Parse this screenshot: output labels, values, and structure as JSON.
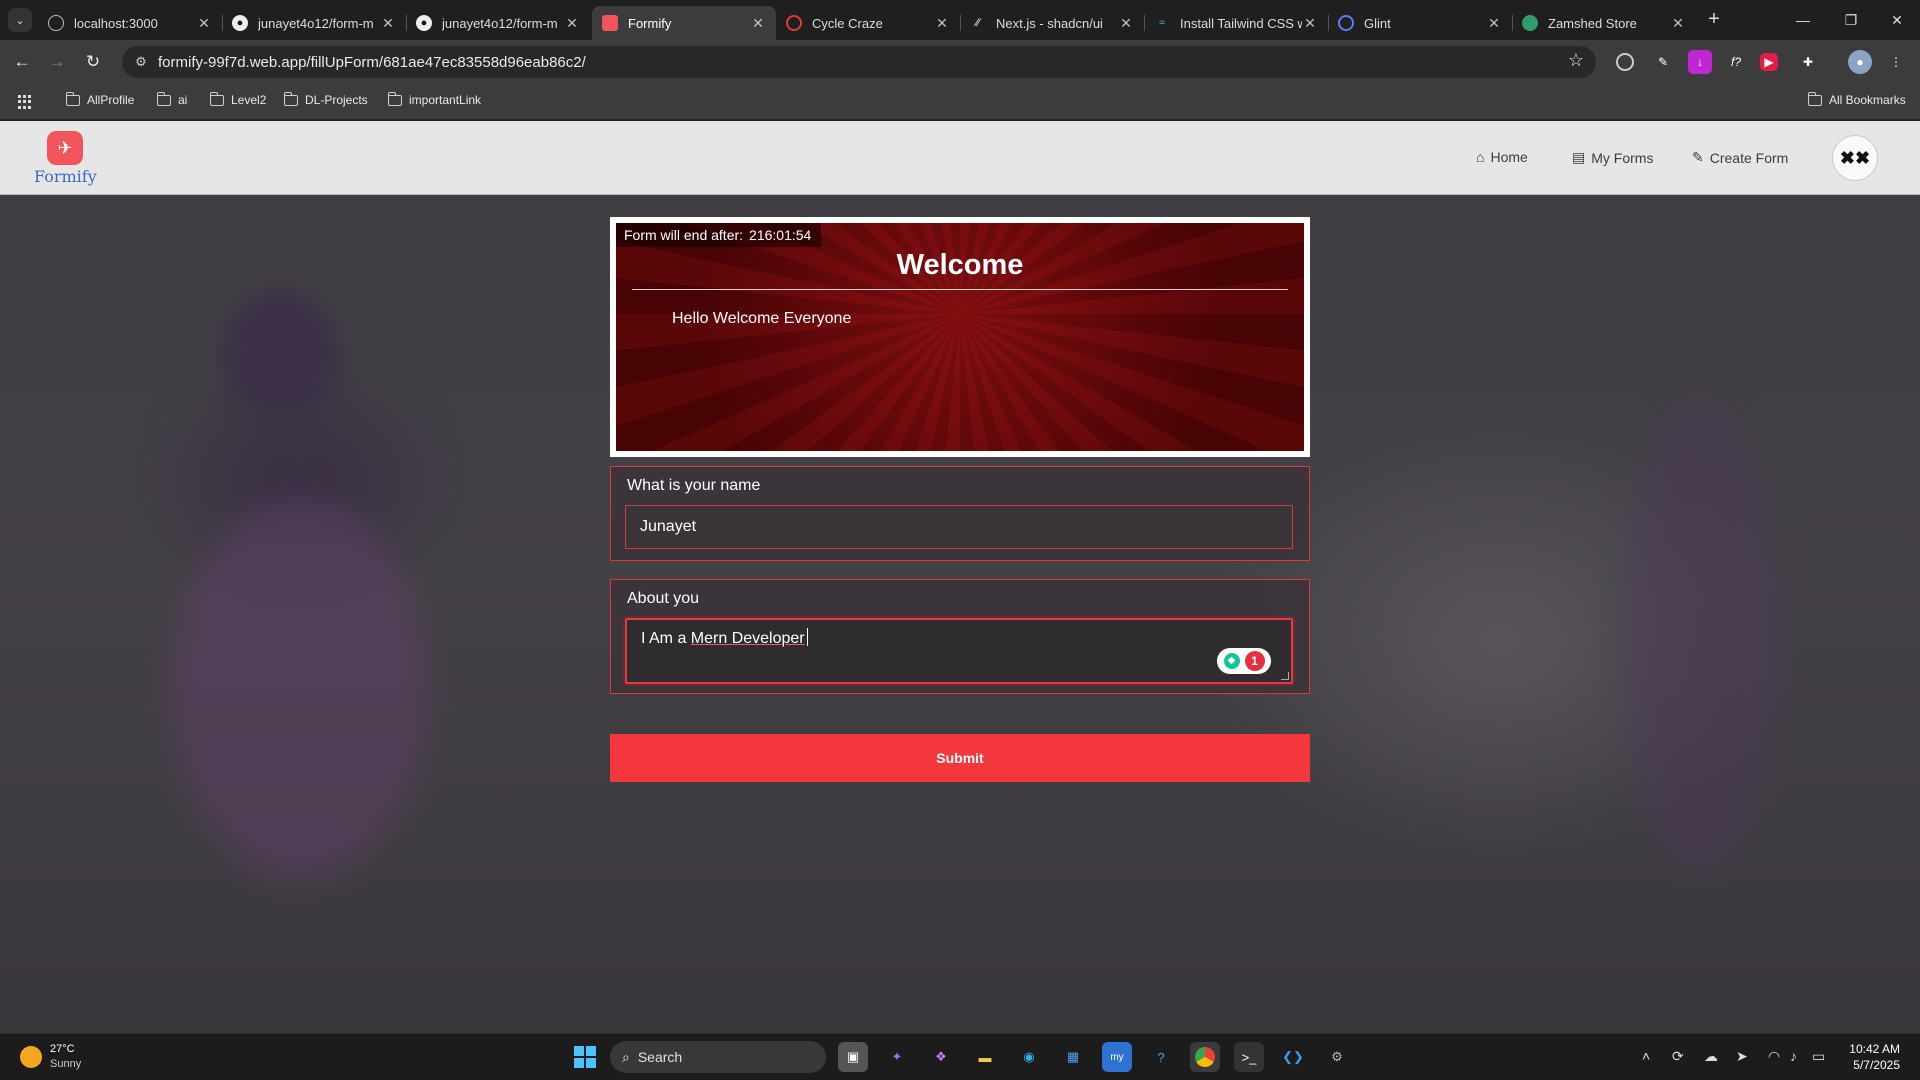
{
  "browser": {
    "tabs": [
      {
        "title": "localhost:3000",
        "icon": "globe-icon"
      },
      {
        "title": "junayet4o12/form-m",
        "icon": "github-icon"
      },
      {
        "title": "junayet4o12/form-m",
        "icon": "github-icon"
      },
      {
        "title": "Formify",
        "icon": "formify-icon",
        "active": true
      },
      {
        "title": "Cycle Craze",
        "icon": "cycle-icon"
      },
      {
        "title": "Next.js - shadcn/ui",
        "icon": "shadcn-icon"
      },
      {
        "title": "Install Tailwind CSS w",
        "icon": "tailwind-icon"
      },
      {
        "title": "Glint",
        "icon": "glint-icon"
      },
      {
        "title": "Zamshed Store",
        "icon": "store-icon"
      }
    ],
    "url": "formify-99f7d.web.app/fillUpForm/681ae47ec83558d96eab86c2/",
    "bookmarks": [
      "AllProfile",
      "ai",
      "Level2",
      "DL-Projects",
      "importantLink"
    ],
    "all_bookmarks_label": "All Bookmarks"
  },
  "site": {
    "logo_text": "Formify",
    "nav": {
      "home": "Home",
      "my_forms": "My Forms",
      "create_form": "Create Form"
    }
  },
  "form": {
    "timer_label": "Form will end after:",
    "timer_value": "216:01:54",
    "title": "Welcome",
    "description": "Hello Welcome Everyone",
    "questions": [
      {
        "label": "What is your name",
        "value": "Junayet"
      },
      {
        "label": "About you",
        "value_prefix": "I Am a ",
        "value_underlined": "Mern Developer"
      }
    ],
    "grammarly_count": "1",
    "submit_label": "Submit"
  },
  "taskbar": {
    "weather_temp": "27°C",
    "weather_desc": "Sunny",
    "search_placeholder": "Search",
    "time": "10:42 AM",
    "date": "5/7/2025"
  },
  "colors": {
    "accent": "#f4373d",
    "header_red": "#6a0a0c",
    "logo_blue": "#3b6ac9"
  }
}
